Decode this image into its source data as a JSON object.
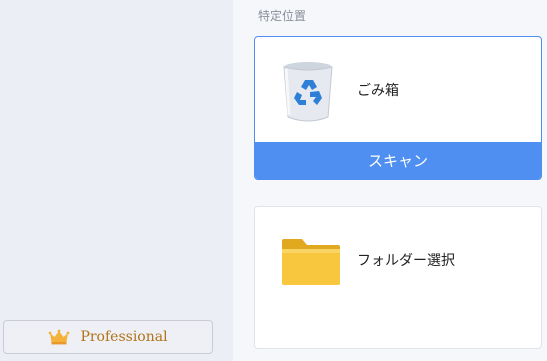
{
  "sidebar": {
    "pro_button": {
      "label": "Professional",
      "icon": "crown-icon"
    }
  },
  "main": {
    "section_title": "特定位置",
    "cards": [
      {
        "label": "ごみ箱",
        "icon": "recycle-bin-icon",
        "action_label": "スキャン"
      },
      {
        "label": "フォルダー選択",
        "icon": "folder-icon"
      }
    ]
  },
  "colors": {
    "accent": "#4f8ff2",
    "pro_text": "#b07318",
    "folder": "#f9c73d"
  }
}
